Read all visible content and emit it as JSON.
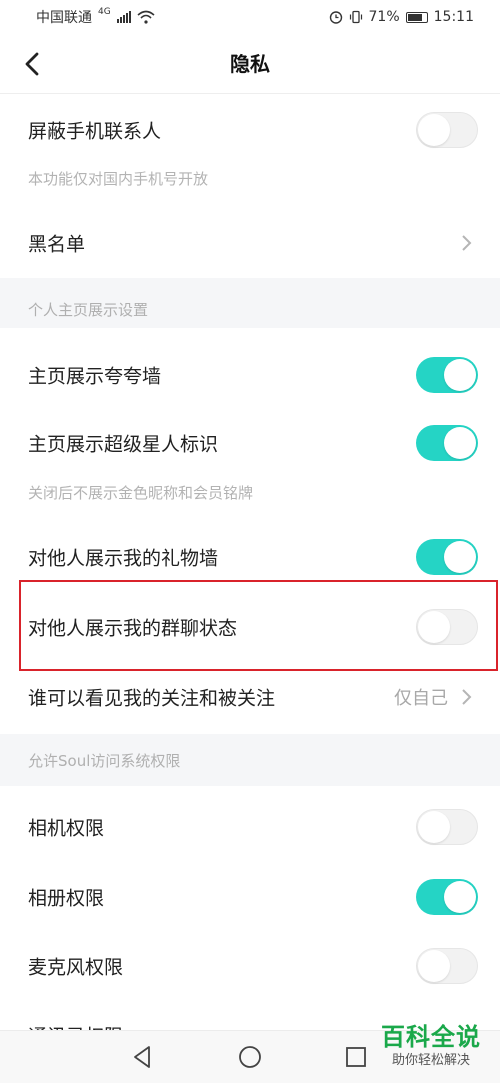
{
  "status_bar": {
    "carrier": "中国联通",
    "network": "4G",
    "battery": "71%",
    "time": "15:11"
  },
  "header": {
    "title": "隐私"
  },
  "rows": {
    "block_contacts": {
      "label": "屏蔽手机联系人",
      "sub": "本功能仅对国内手机号开放",
      "on": false
    },
    "blacklist": {
      "label": "黑名单"
    },
    "section_profile": "个人主页展示设置",
    "praise_wall": {
      "label": "主页展示夸夸墙",
      "on": true
    },
    "super_star": {
      "label": "主页展示超级星人标识",
      "sub": "关闭后不展示金色昵称和会员铭牌",
      "on": true
    },
    "gift_wall": {
      "label": "对他人展示我的礼物墙",
      "on": true
    },
    "group_chat": {
      "label": "对他人展示我的群聊状态",
      "on": false
    },
    "follow_visibility": {
      "label": "谁可以看见我的关注和被关注",
      "value": "仅自己"
    },
    "section_permissions": "允许Soul访问系统权限",
    "camera": {
      "label": "相机权限",
      "on": false
    },
    "album": {
      "label": "相册权限",
      "on": true
    },
    "microphone": {
      "label": "麦克风权限",
      "on": false
    },
    "contacts_partial": {
      "label": "通讯录权限"
    }
  },
  "watermark": {
    "main": "百科全说",
    "sub": "助你轻松解决"
  },
  "colors": {
    "toggle_on": "#25d4c5",
    "highlight": "#d9232b",
    "watermark": "#1aa84a"
  }
}
